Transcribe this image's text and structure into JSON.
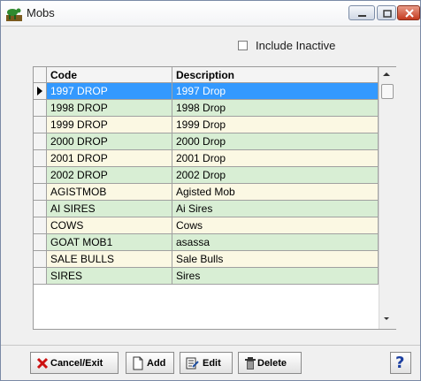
{
  "window": {
    "title": "Mobs",
    "icon": "cattle-app-icon",
    "controls": [
      "minimize",
      "maximize",
      "close"
    ]
  },
  "filter": {
    "include_inactive_label": "Include Inactive",
    "include_inactive_checked": false
  },
  "grid": {
    "columns": [
      "Code",
      "Description"
    ],
    "selected_index": 0,
    "rows": [
      {
        "code": "1997 DROP",
        "description": "1997 Drop"
      },
      {
        "code": "1998 DROP",
        "description": "1998 Drop"
      },
      {
        "code": "1999 DROP",
        "description": "1999 Drop"
      },
      {
        "code": "2000 DROP",
        "description": "2000 Drop"
      },
      {
        "code": "2001 DROP",
        "description": "2001 Drop"
      },
      {
        "code": "2002 DROP",
        "description": "2002 Drop"
      },
      {
        "code": "AGISTMOB",
        "description": "Agisted Mob"
      },
      {
        "code": "AI SIRES",
        "description": "Ai Sires"
      },
      {
        "code": "COWS",
        "description": "Cows"
      },
      {
        "code": "GOAT MOB1",
        "description": "asassa"
      },
      {
        "code": "SALE BULLS",
        "description": "Sale Bulls"
      },
      {
        "code": "SIRES",
        "description": "Sires"
      }
    ]
  },
  "toolbar": {
    "cancel_label": "Cancel/Exit",
    "add_label": "Add",
    "edit_label": "Edit",
    "delete_label": "Delete",
    "help_label": "?"
  },
  "colors": {
    "selected_row": "#3399ff",
    "row_yellow": "#fbf8e3",
    "row_green": "#d8eed4",
    "help_blue": "#1c3fa0"
  }
}
